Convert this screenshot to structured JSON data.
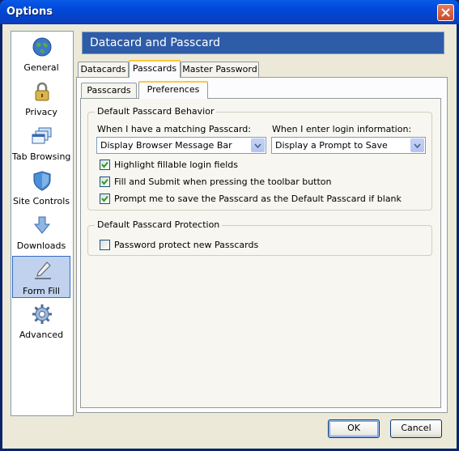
{
  "window": {
    "title": "Options"
  },
  "sidebar": {
    "items": [
      {
        "label": "General",
        "icon": "globe-icon"
      },
      {
        "label": "Privacy",
        "icon": "lock-icon"
      },
      {
        "label": "Tab Browsing",
        "icon": "tabs-icon"
      },
      {
        "label": "Site Controls",
        "icon": "shield-icon"
      },
      {
        "label": "Downloads",
        "icon": "download-arrow-icon"
      },
      {
        "label": "Form Fill",
        "icon": "pen-icon",
        "selected": true
      },
      {
        "label": "Advanced",
        "icon": "gear-icon"
      }
    ]
  },
  "header": {
    "title": "Datacard and Passcard"
  },
  "tabs": [
    {
      "label": "Datacards"
    },
    {
      "label": "Passcards",
      "active": true
    },
    {
      "label": "Master Password"
    }
  ],
  "subtabs": [
    {
      "label": "Passcards"
    },
    {
      "label": "Preferences",
      "active": true
    }
  ],
  "behavior": {
    "legend": "Default Passcard Behavior",
    "matching_label": "When I have a matching Passcard:",
    "matching_value": "Display Browser Message Bar",
    "login_label": "When I enter login information:",
    "login_value": "Display a Prompt to Save",
    "checkboxes": [
      {
        "label": "Highlight fillable login fields",
        "checked": true
      },
      {
        "label": "Fill and Submit when pressing the toolbar button",
        "checked": true
      },
      {
        "label": "Prompt me to save the Passcard as the Default Passcard if blank",
        "checked": true
      }
    ]
  },
  "protection": {
    "legend": "Default Passcard Protection",
    "checkbox": {
      "label": "Password protect new Passcards",
      "checked": false
    }
  },
  "buttons": {
    "ok": "OK",
    "cancel": "Cancel"
  },
  "colors": {
    "title_bar": "#0048d8",
    "header": "#2e5ca8",
    "tab_highlight": "#ffc83c",
    "selection": "#c1d2ee"
  }
}
